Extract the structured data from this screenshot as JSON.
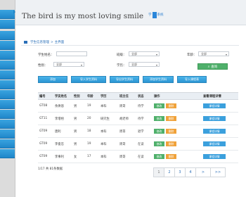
{
  "header": {
    "title": "The bird is my most loving smile",
    "logo_text_left": "学",
    "logo_text_right": "系统"
  },
  "breadcrumb": {
    "items": [
      "学生信息管理",
      ">",
      "主界面"
    ]
  },
  "filters": {
    "student_name_label": "学生姓名：",
    "student_name_value": "",
    "class_label": "班级：",
    "class_value": "全部",
    "grade_label": "年龄：",
    "grade_value": "全部",
    "gender_label": "性别：",
    "gender_value": "全部",
    "education_label": "学历：",
    "education_value": "全部",
    "search_label": "查询"
  },
  "toolbar": {
    "buttons": [
      "添加",
      "导入学生资料",
      "导出学生资料",
      "添加学生资料",
      "导入课程表"
    ]
  },
  "table": {
    "columns": [
      "编号",
      "学员姓名",
      "性别",
      "年龄",
      "学历",
      "班主任",
      "状态",
      "操作",
      "查看课程详情"
    ],
    "rows": [
      {
        "id": "GT08",
        "name": "余焕恩",
        "gender": "男",
        "age": "19",
        "edu": "本科",
        "teacher": "周哥",
        "status": "待学",
        "op1": "修改",
        "op2": "删除",
        "detail": "课程详情"
      },
      {
        "id": "GT11",
        "name": "李增梧",
        "gender": "男",
        "age": "20",
        "edu": "研究生",
        "teacher": "胡老师",
        "status": "待学",
        "op1": "修改",
        "op2": "删除",
        "detail": "课程详情"
      },
      {
        "id": "GT09",
        "name": "唐利",
        "gender": "男",
        "age": "18",
        "edu": "本科",
        "teacher": "周哥",
        "status": "退学",
        "op1": "修改",
        "op2": "删除",
        "detail": "课程详情"
      },
      {
        "id": "GT09",
        "name": "李俊忠",
        "gender": "男",
        "age": "19",
        "edu": "本科",
        "teacher": "周哥",
        "status": "在读",
        "op1": "修改",
        "op2": "删除",
        "detail": "课程详情"
      },
      {
        "id": "GT09",
        "name": "李事利",
        "gender": "女",
        "age": "17",
        "edu": "本科",
        "teacher": "周哥",
        "status": "在读",
        "op1": "修改",
        "op2": "删除",
        "detail": "课程详情"
      }
    ]
  },
  "footer": {
    "total_text": "1/17 共 81条数据"
  },
  "pagination": {
    "pages": [
      "1",
      "2",
      "3",
      "4",
      ">",
      ">>"
    ],
    "active_page": "1"
  },
  "colors": {
    "accent_blue": "#2b95d3",
    "green": "#4fb06b",
    "orange": "#f0a23a"
  }
}
